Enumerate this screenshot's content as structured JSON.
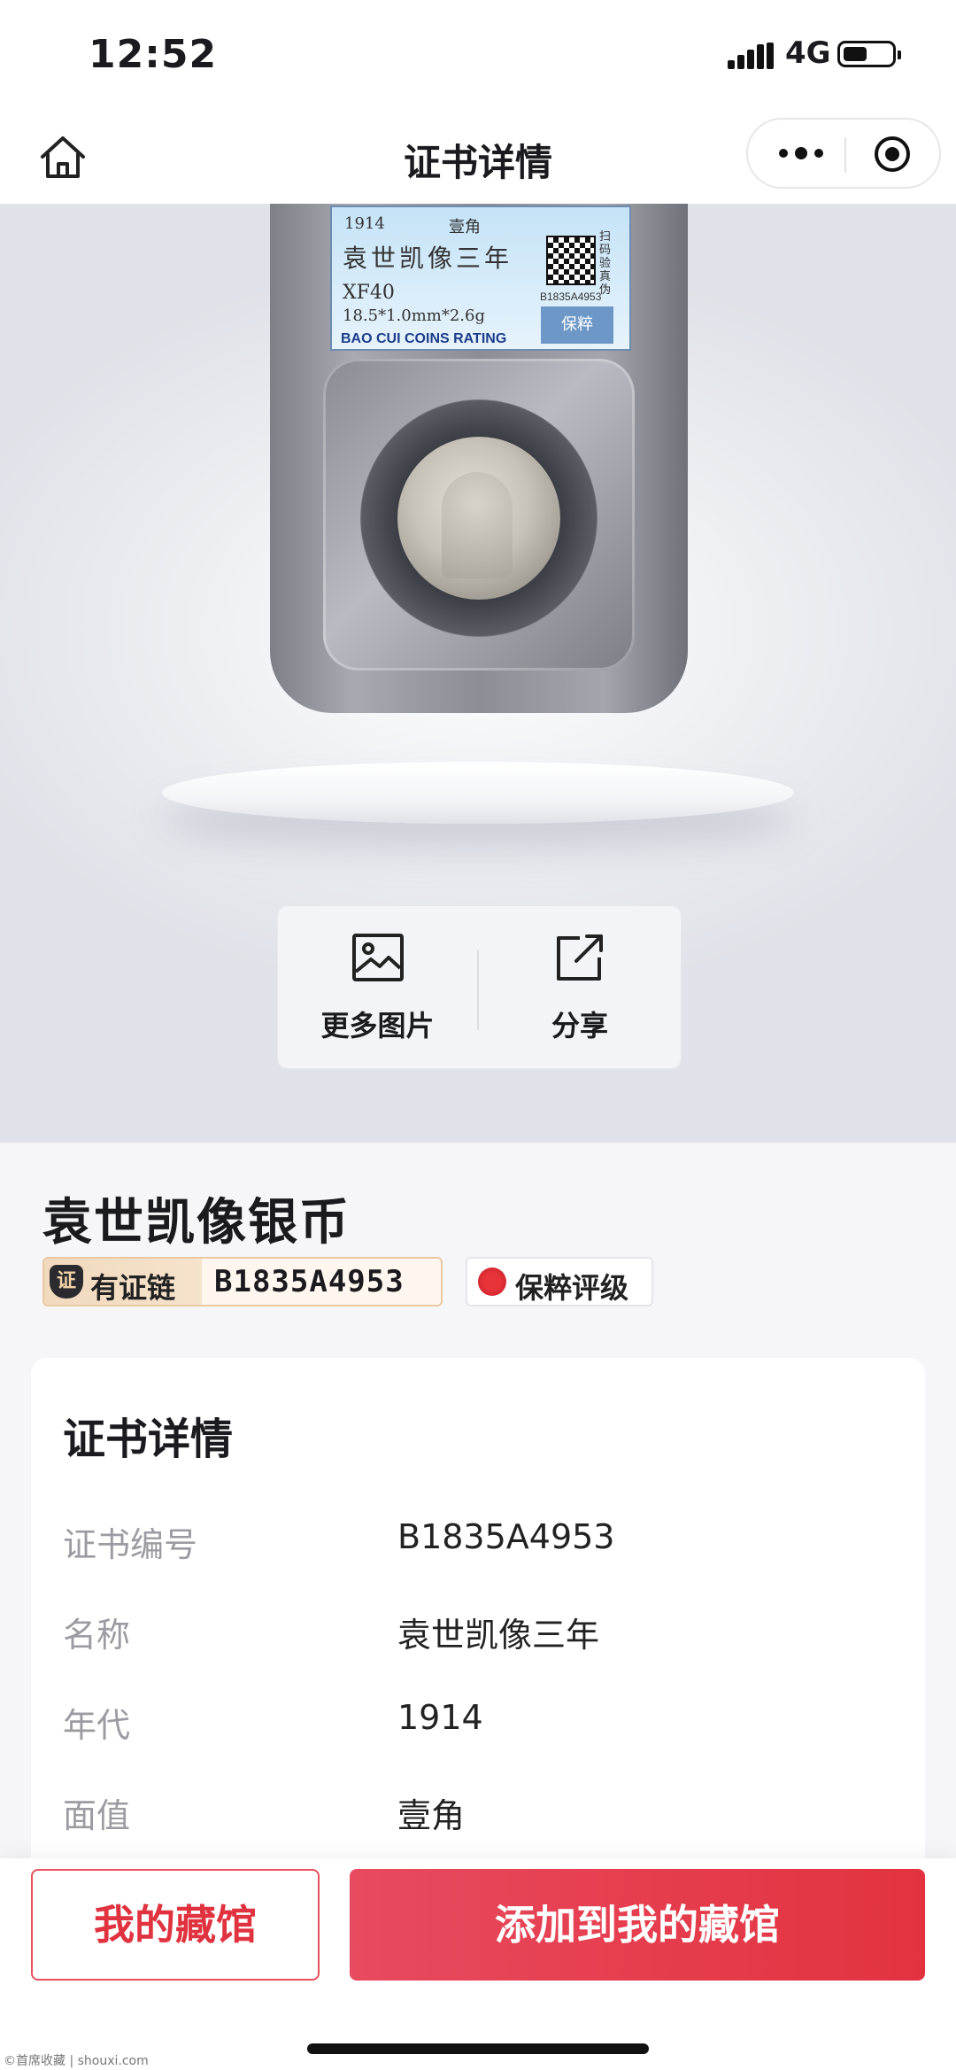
{
  "status_bar": {
    "time": "12:52",
    "network": "4G"
  },
  "nav": {
    "title": "证书详情"
  },
  "slab_label": {
    "year": "1914",
    "denomination": "壹角",
    "name": "袁世凯像三年",
    "grade": "XF40",
    "spec": "18.5*1.0mm*2.6g",
    "brand": "BAO CUI COINS RATING",
    "scan_text": "扫码验真伪",
    "cert_no": "B1835A4953",
    "logo_text": "保粹"
  },
  "actions": {
    "more_images": "更多图片",
    "share": "分享"
  },
  "item": {
    "title": "袁世凯像银币",
    "chain_label": "有证链",
    "chain_shield": "证",
    "chain_number": "B1835A4953",
    "grader": "保粹评级"
  },
  "details": {
    "title": "证书详情",
    "rows": [
      {
        "label": "证书编号",
        "value": "B1835A4953"
      },
      {
        "label": "名称",
        "value": "袁世凯像三年"
      },
      {
        "label": "年代",
        "value": "1914"
      },
      {
        "label": "面值",
        "value": "壹角"
      }
    ]
  },
  "buttons": {
    "my_collection": "我的藏馆",
    "add_to_collection": "添加到我的藏馆"
  },
  "watermark": "©首席收藏 | shouxi.com",
  "colors": {
    "accent": "#e3323f",
    "chain_gold": "#f1d9bd"
  }
}
